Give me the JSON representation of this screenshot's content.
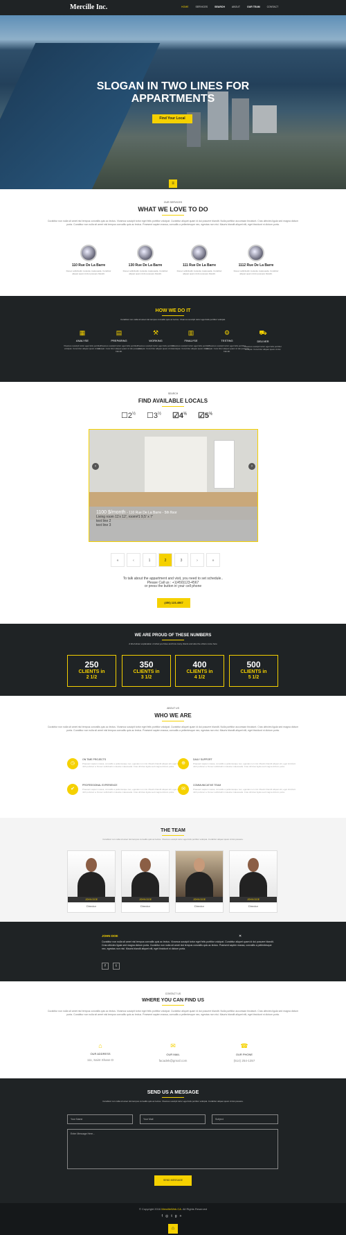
{
  "nav": {
    "logo": "Mercille Inc.",
    "items": [
      "HOME",
      "SERVICES",
      "SEARCH",
      "ABOUT",
      "OUR TEAM",
      "CONTACT"
    ]
  },
  "hero": {
    "title_line1": "SLOGAN IN TWO LINES FOR",
    "title_line2": "APPARTMENTS",
    "button": "Find Your Local"
  },
  "services": {
    "kicker": "OUR SERVICES",
    "title": "WHAT WE LOVE TO DO",
    "text": "Curabitur non nulla sit amet nisl tempus convallis quis ac lectus. Vivamus suscipit tortor eget felis porttitor volutpat. Curabitur aliquet quam id dui posuere blandit. Nulla porttitor accumsan tincidunt. Cras ultricies ligula sed magna dictum porta. Curabitur non nulla sit amet nisl tempus convallis quis ac lectus. Praesent sapien massa, convallis a pellentesque nec, egestas non nisi. Mauris blandit aliquet elit, eget tincidunt ni dictum porta.",
    "locations": [
      {
        "name": "110 Rue De La Barre",
        "text": "Donec sollicitudin molestie malesuada. Curabitur aliquet quam id dui posuere blandit."
      },
      {
        "name": "130 Rue De La Barre",
        "text": "Donec sollicitudin molestie malesuada. Curabitur aliquet quam id dui posuere blandit."
      },
      {
        "name": "111 Rue De La Barre",
        "text": "Donec sollicitudin molestie malesuada. Curabitur aliquet quam id dui posuere blandit."
      },
      {
        "name": "1112 Rue De La Barre",
        "text": "Donec sollicitudin molestie malesuada. Curabitur aliquet quam id dui posuere blandit."
      }
    ]
  },
  "how": {
    "title": "HOW WE DO IT",
    "text": "Curabitur non nulla sit amet nisl tempus convallis quis ac lectus. Vivamus suscipit tortor eget felis porttitor volutpat.",
    "steps": [
      {
        "label": "ANALYSE",
        "text": "Vivamus suscipit tortor eget felis porttitor volutpat. Cura bitur aliquet quam id dui."
      },
      {
        "label": "PREPARING",
        "text": "Vivamus suscipit tortor eget felis porttitor volutpat. Cura bitur aliquet quam id dui posuere blandit."
      },
      {
        "label": "WORKING",
        "text": "Vivamus suscipit tortor eget felis porttitor volutpat. Cura bitur aliquet quam id dui."
      },
      {
        "label": "FINALYSE",
        "text": "Vivamus suscipit tortor eget felis porttitor volutpat. Cura bitur aliquet quam id dui."
      },
      {
        "label": "TESTING",
        "text": "Vivamus suscipit tortor eget felis porttitor volutpat. Cura bitur aliquet quam id dui posuere blandit."
      },
      {
        "label": "DELIVER",
        "text": "Vivamus suscipit tortor eget felis porttitor volutpat. Cura bitur aliquet quam id dui."
      }
    ]
  },
  "locals": {
    "kicker": "SEARCH",
    "title": "FIND AVAILABLE LOCALS",
    "filters": [
      {
        "label": "2",
        "unit": "½",
        "checked": false
      },
      {
        "label": "3",
        "unit": "½",
        "checked": false
      },
      {
        "label": "4",
        "unit": "½",
        "checked": true
      },
      {
        "label": "5",
        "unit": "½",
        "checked": true
      }
    ],
    "slide": {
      "price": "1100 $/month",
      "address": "- 110 Rue De La Barre - 5th floor",
      "line1": "Living room 11'x 12', room#1  9,5' x 7'",
      "line2": "text line 2",
      "line3": "text line 3"
    },
    "pager": [
      "«",
      "‹",
      "1",
      "2",
      "3",
      "›",
      "»"
    ],
    "cta_line1": "To talk about the appartment and visit, you need to set schedule..",
    "cta_line2": "Please Call us : +1(450)123-4567",
    "cta_line3": "or press the button in your cell phone",
    "call_button": "(450) 123-4567"
  },
  "numbers": {
    "title": "WE ARE PROUD OF THESE NUMBERS",
    "text": "A brief about explanation of what you have and how many clients and also the others come here",
    "items": [
      {
        "n": "250",
        "l1": "CLIENTS in",
        "l2": "2 1/2"
      },
      {
        "n": "350",
        "l1": "CLIENTS in",
        "l2": "3 1/2"
      },
      {
        "n": "400",
        "l1": "CLIENTS in",
        "l2": "4 1/2"
      },
      {
        "n": "500",
        "l1": "CLIENTS in",
        "l2": "5 1/2"
      }
    ]
  },
  "about": {
    "kicker": "ABOUT US",
    "title": "WHO WE ARE",
    "text": "Curabitur non nulla sit amet nisl tempus convallis quis ac lectus. Vivamus suscipit tortor eget felis porttitor volutpat. Curabitur aliquet quam id dui posuere blandit. Nulla porttitor accumsan tincidunt. Cras ultricies ligula sed magna dictum porta. Curabitur non nulla sit amet nisl tempus convallis quis ac lectus. Praesent sapien massa, convallis a pellentesque nec, egestas non nisi. Mauris blandit aliquet elit, eget tincidunt ni dictum porta.",
    "features": [
      {
        "title": "ON TIME PROJECTS",
        "text": "Praesent sapien massa, convallis a pellentesque nec, egestas non nisi. Mauris blandit aliquet elit, eget tincidunt nibh pulvinar a. Donec sollicitudin molestie malesuada. Cras ultricies ligula sed magna dictum porta."
      },
      {
        "title": "DAILY SUPPORT",
        "text": "Praesent sapien massa, convallis a pellentesque nec, egestas non nisi. Mauris blandit aliquet elit, eget tincidunt nibh pulvinar a. Donec sollicitudin molestie malesuada. Cras ultricies ligula sed magna dictum porta."
      },
      {
        "title": "PROFESSIONAL EXPERIENCE",
        "text": "Praesent sapien massa, convallis a pellentesque nec, egestas non nisi. Mauris blandit aliquet elit, eget tincidunt nibh pulvinar a. Donec sollicitudin molestie malesuada. Cras ultricies ligula sed magna dictum porta."
      },
      {
        "title": "COMMUNICATIVE TEAM",
        "text": "Praesent sapien massa, convallis a pellentesque nec, egestas non nisi. Mauris blandit aliquet elit, eget tincidunt nibh pulvinar a. Donec sollicitudin molestie malesuada. Cras ultricies ligula sed magna dictum porta."
      }
    ]
  },
  "team": {
    "title": "THE TEAM",
    "text": "Curabitur non nulla sit amet nisl tempus convallis quis ac lectus. Vivamus suscipit tortor eget felis porttitor volutpat. Curabitur aliquet quam id dui posuere.",
    "members": [
      {
        "name": "JOHN DOE",
        "role": "Director"
      },
      {
        "name": "JOHN DOE",
        "role": "Director"
      },
      {
        "name": "JOHN DOE",
        "role": "Director"
      },
      {
        "name": "JOHN DOE",
        "role": "Director"
      }
    ]
  },
  "profile": {
    "name": "JOHN DOE",
    "text": "Curabitur non nulla sit amet nisl tempus convallis quis ac lectus. Vivamus suscipit tortor eget felis porttitor volutpat. Curabitur aliquet quam id dui posuere blandit. Cras ultricies ligula sed magna dictum porta. Curabitur non nulla sit amet nisl tempus convallis quis ac lectus. Praesent sapien massa, convallis a pellentesque nec, egestas non nisi. Mauris blandit aliquet elit, eget tincidunt ni dictum porta.",
    "close": "✕"
  },
  "contact": {
    "kicker": "CONTACT US",
    "title": "WHERE YOU CAN FIND US",
    "text": "Curabitur non nulla sit amet nisl tempus convallis quis ac lectus. Vivamus suscipit tortor eget felis porttitor volutpat. Curabitur aliquet quam id dui posuere blandit. Nulla porttitor accumsan tincidunt. Cras ultricies ligula sed magna dictum porta. Curabitur non nulla sit amet nisl tempus convallis quis ac lectus. Praesent sapien massa, convallis a pellentesque nec, egestas non nisi. Mauris blandit aliquet elit, eget tincidunt ni dictum porta.",
    "address_label": "OUR ADDRESS",
    "address": "111, Saint Shane D",
    "mail_label": "OUR MAIL",
    "mail": "facadek@gmail.com",
    "phone_label": "OUR PHONE",
    "phone": "(514) 254-1357"
  },
  "message": {
    "title": "SEND US A MESSAGE",
    "text": "Curabitur non nulla sit amet nisl tempus convallis quis ac lectus. Vivamus suscipit tortor eget felis porttitor volutpat. Curabitur aliquet quam id dui posuere.",
    "name_placeholder": "Your Name",
    "mail_placeholder": "Your Mail",
    "subject_placeholder": "Subject",
    "message_placeholder": "Enter Message Here...",
    "send": "SEND MESSAGE"
  },
  "footer": {
    "copyright": "© Copyright 2016",
    "site": "MercilleWeb.CA",
    "rights": ". All Rights Reserved"
  },
  "colors": {
    "accent": "#f5d100",
    "dark": "#1f2325"
  }
}
